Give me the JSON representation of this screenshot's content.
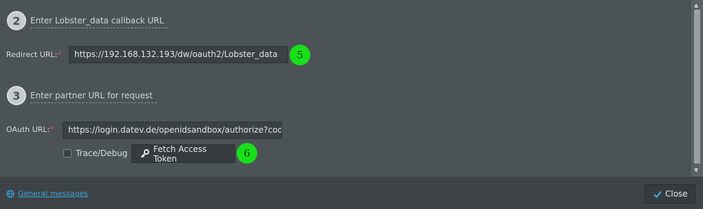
{
  "step2": {
    "number": "2",
    "title": "Enter Lobster_data callback URL"
  },
  "redirect": {
    "label": "Redirect URL:",
    "required": "*",
    "value": "https://192.168.132.193/dw/oauth2/Lobster_data",
    "badge": "5"
  },
  "step3": {
    "number": "3",
    "title": "Enter partner URL for request"
  },
  "oauth": {
    "label": "OAuth URL:",
    "required": "*",
    "value": "https://login.datev.de/openidsandbox/authorize?code_"
  },
  "trace": {
    "label": "Trace/Debug",
    "checked": false
  },
  "fetch_button": {
    "label": "Fetch Access Token",
    "icon": "key-icon",
    "badge": "6"
  },
  "footer": {
    "link_label": "General messages",
    "link_icon": "globe-icon",
    "close_label": "Close",
    "close_icon": "check-icon"
  },
  "colors": {
    "badge": "#18e018",
    "link": "#3aa3d8",
    "required": "#e74c3c",
    "check": "#3aa3d8"
  }
}
